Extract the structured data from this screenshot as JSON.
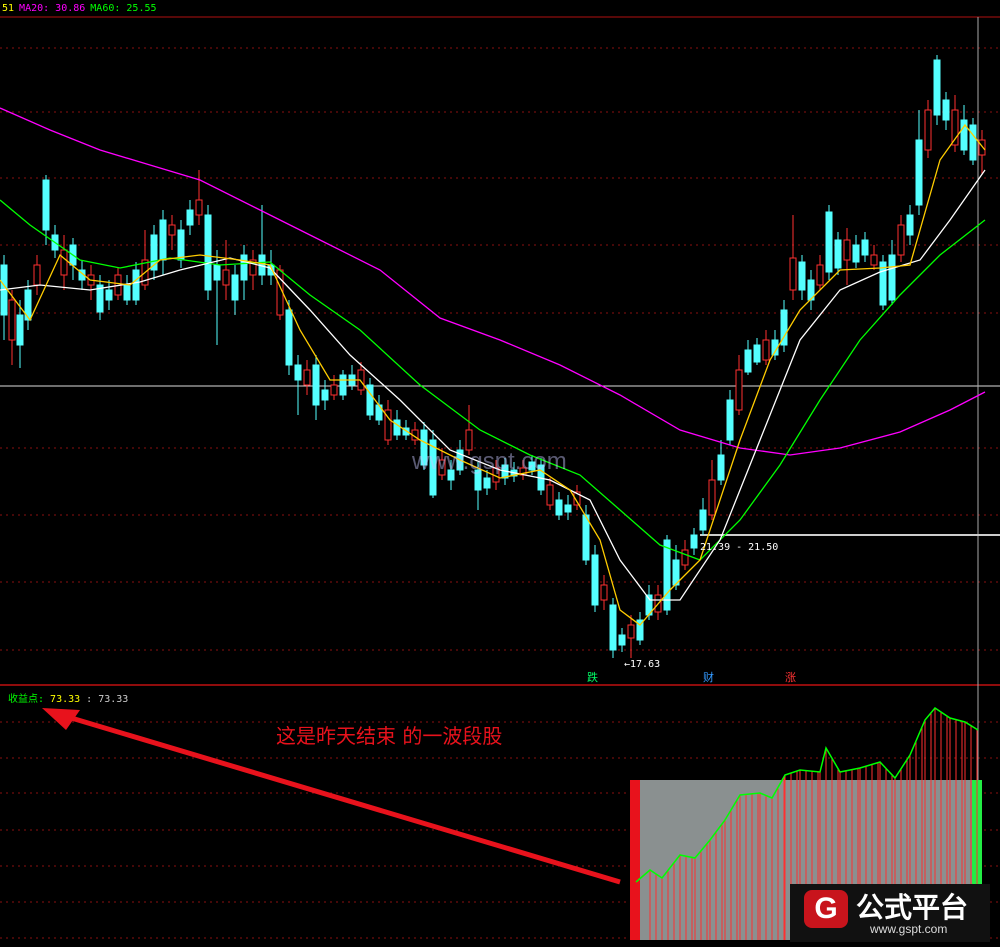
{
  "header": {
    "ma_values": [
      {
        "text": "51",
        "color": "#ffff00"
      },
      {
        "text": "MA20: 30.86",
        "color": "#ff00ff"
      },
      {
        "text": "MA60: 25.55",
        "color": "#00ff00"
      }
    ]
  },
  "indicator_header": {
    "name": "收益点",
    "v1": "73.33",
    "v2": "73.33"
  },
  "annotation": "这是昨天结束 的一波段股",
  "watermark": "www.gspt.com",
  "logo": {
    "mark": "G",
    "text": "公式平台",
    "url": "www.gspt.com"
  },
  "chart_data": [
    {
      "type": "candlestick",
      "title": "",
      "series": [
        {
          "name": "MA20",
          "color": "#ff00ff"
        },
        {
          "name": "MA60",
          "color": "#00ff00"
        },
        {
          "name": "short MA",
          "color": "#ffffff"
        },
        {
          "name": "mid MA",
          "color": "#ffcc00"
        }
      ],
      "annotations": [
        {
          "text": "17.63",
          "kind": "low"
        },
        {
          "text": "21.39 - 21.50",
          "kind": "level"
        }
      ],
      "markers": [
        {
          "text": "跌",
          "color": "#00ff66"
        },
        {
          "text": "财",
          "color": "#3399ff"
        },
        {
          "text": "涨",
          "color": "#ff3333"
        }
      ],
      "colors": {
        "up": "#ff3030",
        "down": "#54ffff"
      }
    },
    {
      "type": "area",
      "title": "",
      "name": "收益点",
      "last_value": 73.33,
      "colors": {
        "line": "#00ff00",
        "bars": "#ff3030",
        "highlight": "#8a9090"
      }
    }
  ]
}
